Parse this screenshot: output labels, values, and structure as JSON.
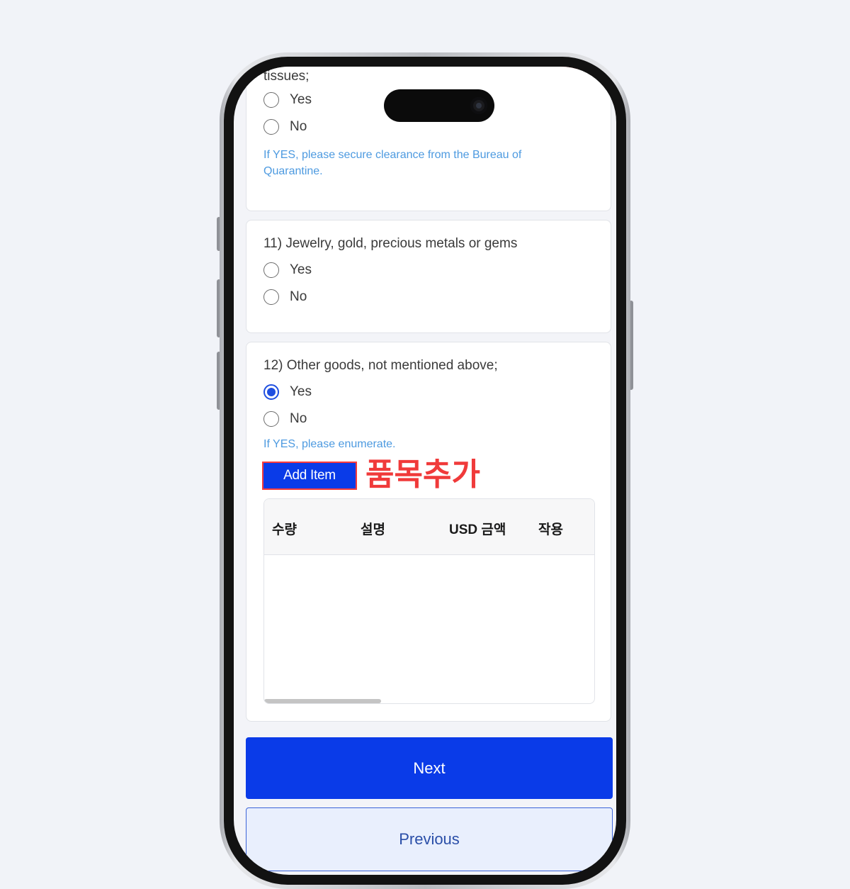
{
  "q10": {
    "text": "tissues;",
    "options": [
      "Yes",
      "No"
    ],
    "hint": "If YES, please secure clearance from the Bureau of Quarantine.",
    "selected": null
  },
  "q11": {
    "text": "11) Jewelry, gold, precious metals or gems",
    "options": [
      "Yes",
      "No"
    ],
    "selected": null
  },
  "q12": {
    "text": "12) Other goods, not mentioned above;",
    "options": [
      "Yes",
      "No"
    ],
    "selected": "Yes",
    "hint": "If YES, please enumerate.",
    "add_item_label": "Add Item",
    "annotation": "품목추가",
    "table": {
      "columns": [
        "수량",
        "설명",
        "USD 금액",
        "작용"
      ],
      "rows": []
    }
  },
  "nav": {
    "next_label": "Next",
    "previous_label": "Previous"
  },
  "colors": {
    "primary": "#0a3be8",
    "hint": "#4d9ae0",
    "annotation": "#f03a3a"
  }
}
